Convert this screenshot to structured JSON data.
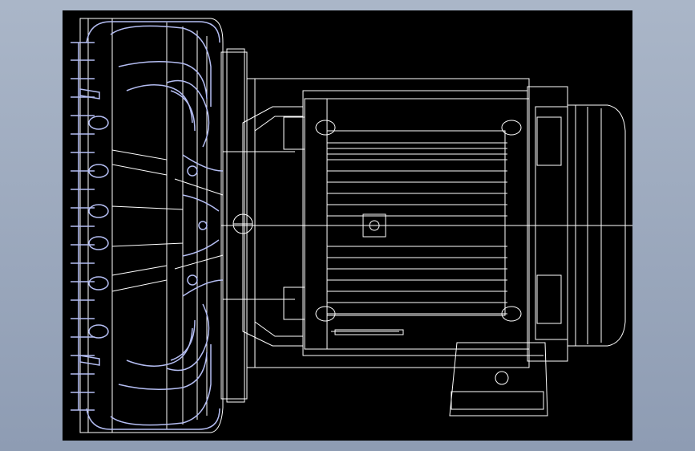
{
  "app": {
    "background_color": "#9aa7bb",
    "viewport_color": "#000000",
    "line_color": "#ffffff",
    "accent_line_color": "#b4bdf2"
  },
  "drawing": {
    "subject": "side-blower-motor-wireframe",
    "icon": "wireframe-drawing-icon"
  }
}
